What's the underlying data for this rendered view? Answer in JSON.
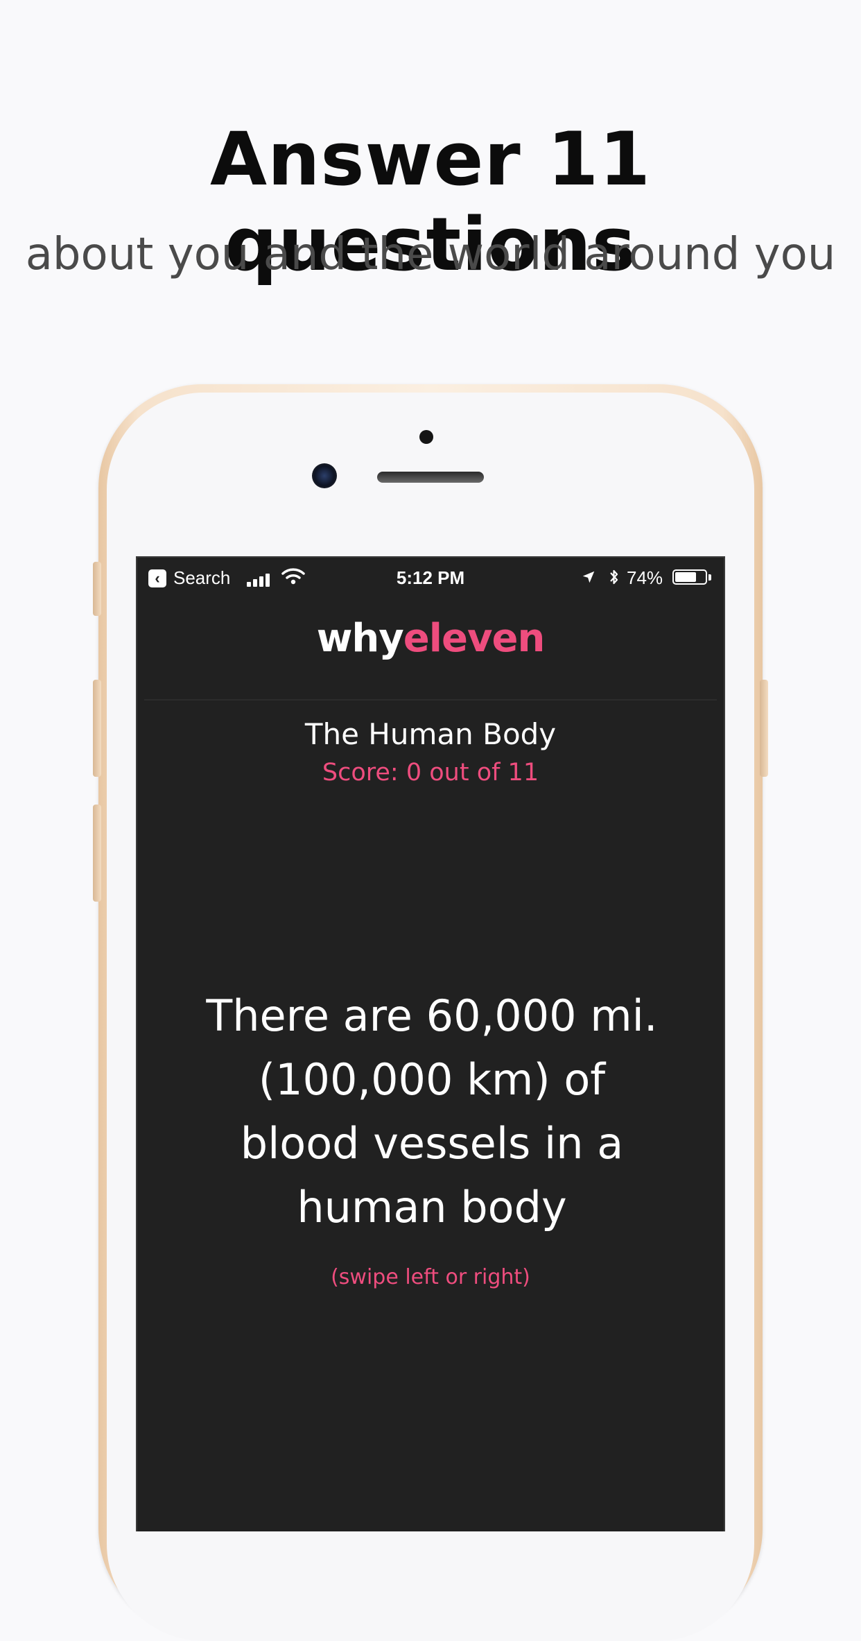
{
  "promo": {
    "headline": "Answer 11 questions",
    "subheadline": "about you and the world around you"
  },
  "status_bar": {
    "back_label": "Search",
    "time": "5:12 PM",
    "battery_percent": "74%",
    "battery_level": 0.74
  },
  "app": {
    "brand_why": "why",
    "brand_eleven": "eleven",
    "category": "The Human Body",
    "score": "Score: 0 out of 11",
    "statement": "There are 60,000 mi. (100,000 km) of blood vessels in a human body",
    "hint": "(swipe left or right)"
  },
  "colors": {
    "accent": "#ee4d7e",
    "screen_bg": "#212121",
    "page_bg": "#f9f9fb"
  }
}
